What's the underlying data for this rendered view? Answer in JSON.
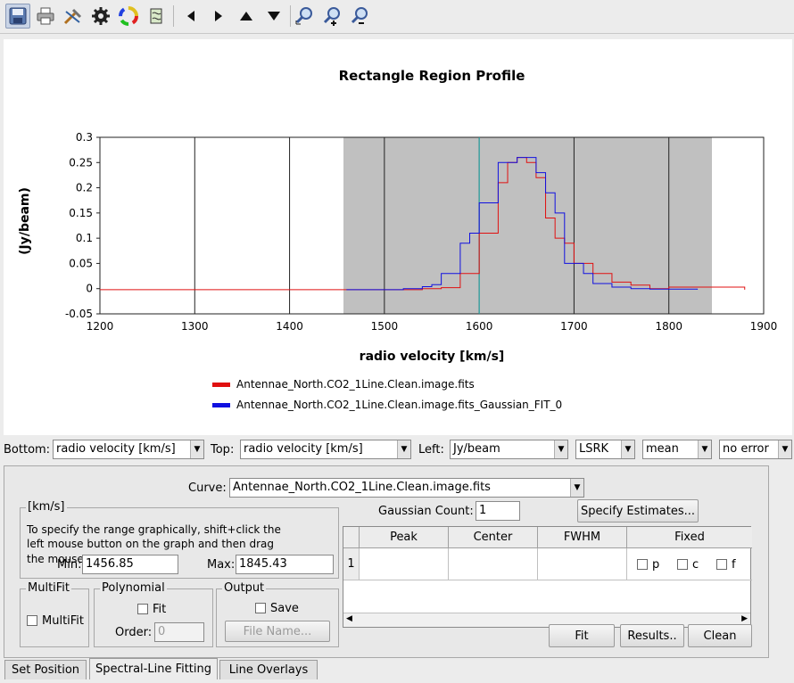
{
  "toolbar": {
    "buttons": [
      "save-icon",
      "print-icon",
      "tools-icon",
      "gear-icon",
      "color-wheel-icon",
      "swap-icon",
      "left-arrow-icon",
      "right-arrow-icon",
      "up-arrow-icon",
      "down-arrow-icon",
      "zoom-fit-icon",
      "zoom-in-icon",
      "zoom-out-icon"
    ]
  },
  "chart_data": {
    "type": "line",
    "title": "Rectangle Region Profile",
    "xlabel": "radio velocity [km/s]",
    "ylabel": "(Jy/beam)",
    "xlim": [
      1200,
      1900
    ],
    "ylim": [
      -0.05,
      0.3
    ],
    "xticks": [
      "1200",
      "1300",
      "1400",
      "1500",
      "1600",
      "1700",
      "1800",
      "1900"
    ],
    "yticks": [
      "0.3",
      "0.25",
      "0.2",
      "0.15",
      "0.1",
      "0.05",
      "0",
      "-0.05"
    ],
    "grid": true,
    "shaded_range": [
      1456.85,
      1845.43
    ],
    "marker_x": 1600,
    "series": [
      {
        "name": "Antennae_North.CO2_1Line.Clean.image.fits",
        "color": "#e01010",
        "x": [
          1200,
          1540,
          1560,
          1580,
          1600,
          1620,
          1630,
          1640,
          1650,
          1660,
          1670,
          1680,
          1690,
          1700,
          1720,
          1740,
          1760,
          1780,
          1800,
          1880
        ],
        "y": [
          -0.002,
          0.0,
          0.002,
          0.03,
          0.11,
          0.21,
          0.25,
          0.26,
          0.25,
          0.22,
          0.14,
          0.1,
          0.09,
          0.05,
          0.03,
          0.013,
          0.007,
          0.0,
          0.003,
          -0.002
        ]
      },
      {
        "name": "Antennae_North.CO2_1Line.Clean.image.fits_Gaussian_FIT_0",
        "color": "#1010e0",
        "x": [
          1460,
          1520,
          1540,
          1550,
          1560,
          1570,
          1580,
          1590,
          1600,
          1610,
          1620,
          1630,
          1640,
          1650,
          1660,
          1670,
          1680,
          1690,
          1700,
          1710,
          1720,
          1740,
          1760,
          1780,
          1830
        ],
        "y": [
          -0.002,
          0.0,
          0.004,
          0.008,
          0.03,
          0.03,
          0.09,
          0.11,
          0.17,
          0.17,
          0.25,
          0.25,
          0.26,
          0.26,
          0.23,
          0.19,
          0.15,
          0.05,
          0.05,
          0.03,
          0.01,
          0.003,
          0.0,
          -0.001,
          -0.002
        ]
      }
    ]
  },
  "axis_controls": {
    "bottom_label": "Bottom:",
    "bottom_value": "radio velocity [km/s]",
    "top_label": "Top:",
    "top_value": "radio velocity [km/s]",
    "left_label": "Left:",
    "left_value": "Jy/beam",
    "frame_value": "LSRK",
    "stat_value": "mean",
    "error_value": "no error"
  },
  "fitting": {
    "curve_label": "Curve:",
    "curve_value": "Antennae_North.CO2_1Line.Clean.image.fits",
    "range_group_title": "[km/s]",
    "range_instructions_1": "To specify the range graphically, shift+click the",
    "range_instructions_2": "left mouse button on the graph and then drag",
    "range_instructions_3": "the mouse",
    "min_label": "Min:",
    "min_value": "1456.85",
    "max_label": "Max:",
    "max_value": "1845.43",
    "multifit_group": "MultiFit",
    "multifit_check": "MultiFit",
    "polynomial_group": "Polynomial",
    "poly_fit_check": "Fit",
    "order_label": "Order:",
    "order_value": "0",
    "output_group": "Output",
    "save_check": "Save",
    "file_name_button": "File Name...",
    "gaussian_count_label": "Gaussian Count:",
    "gaussian_count_value": "1",
    "specify_estimates_button": "Specify Estimates...",
    "table_headers": [
      "Peak",
      "Center",
      "FWHM",
      "Fixed"
    ],
    "row_index": "1",
    "fixed_p": "p",
    "fixed_c": "c",
    "fixed_f": "f",
    "fit_button": "Fit",
    "results_button": "Results..",
    "clean_button": "Clean"
  },
  "tabs": [
    "Set Position",
    "Spectral-Line Fitting",
    "Line Overlays"
  ],
  "active_tab": "Spectral-Line Fitting"
}
